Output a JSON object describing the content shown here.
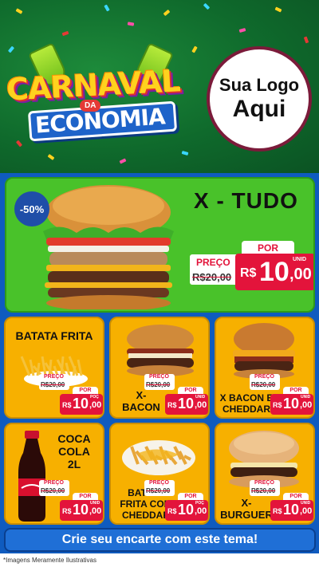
{
  "header": {
    "title_line1": "CARNAVAL",
    "title_da": "DA",
    "title_line2": "ECONOMIA",
    "logo_line1": "Sua Logo",
    "logo_line2": "Aqui"
  },
  "feature": {
    "name": "X - TUDO",
    "discount": "-50%",
    "preco_label": "PREÇO",
    "old_price": "R$20,00",
    "por_label": "POR",
    "currency": "R$",
    "price_int": "10",
    "price_dec": ",00",
    "unid": "UNID"
  },
  "products": [
    {
      "name": "BATATA FRITA",
      "preco_label": "PREÇO",
      "old_price": "R$20,00",
      "por_label": "POR",
      "currency": "R$",
      "price_int": "10",
      "price_dec": ",00",
      "unid": "POÇ"
    },
    {
      "name": "X-\nBACON",
      "preco_label": "PREÇO",
      "old_price": "R$20,00",
      "por_label": "POR",
      "currency": "R$",
      "price_int": "10",
      "price_dec": ",00",
      "unid": "UNID"
    },
    {
      "name": "X BACON E\nCHEDDAR",
      "preco_label": "PREÇO",
      "old_price": "R$20,00",
      "por_label": "POR",
      "currency": "R$",
      "price_int": "10",
      "price_dec": ",00",
      "unid": "UNID"
    },
    {
      "name": "COCA\nCOLA\n2L",
      "preco_label": "PREÇO",
      "old_price": "R$20,00",
      "por_label": "POR",
      "currency": "R$",
      "price_int": "10",
      "price_dec": ",00",
      "unid": "UNID"
    },
    {
      "name": "BATATA\nFRITA COM\nCHEDDAR",
      "preco_label": "PREÇO",
      "old_price": "R$20,00",
      "por_label": "POR",
      "currency": "R$",
      "price_int": "10",
      "price_dec": ",00",
      "unid": "POÇ"
    },
    {
      "name": "X-\nBURGUER",
      "preco_label": "PREÇO",
      "old_price": "R$20,00",
      "por_label": "POR",
      "currency": "R$",
      "price_int": "10",
      "price_dec": ",00",
      "unid": "UNID"
    }
  ],
  "cta": {
    "label": "Crie seu encarte com este tema!"
  },
  "footer": {
    "note": "*Imagens Meramente Ilustrativas"
  },
  "colors": {
    "header_green": "#0f6a2c",
    "feature_green": "#49c22a",
    "card_yellow": "#f7b000",
    "price_red": "#e3143b",
    "bg_blue": "#0f5bbf"
  }
}
